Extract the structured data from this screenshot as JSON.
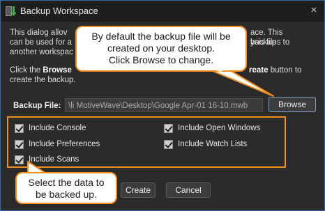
{
  "window": {
    "title": "Backup Workspace",
    "icon": "backup-arrow-icon",
    "close_glyph": "×"
  },
  "dialog": {
    "paragraph1": "This dialog allows you to create a backup of your workspace. This backup can be used for a new installation and to share analysis files to another workspace.",
    "paragraph1_visible_lines": [
      "This dialog allov",
      "can be used for a",
      "another workspac"
    ],
    "paragraph1_line_tails": [
      "ace. This backup",
      "ysis files to",
      ""
    ],
    "paragraph2_line1_start": "Click the ",
    "paragraph2_bold1": "Browse",
    "paragraph2_bold2": "reate",
    "paragraph2_line1_end": " button to",
    "paragraph2_line2": "create the backup."
  },
  "backup_file": {
    "label": "Backup File:",
    "value": "\\li MotiveWave\\Desktop\\Google Apr-01 16-10.mwb",
    "browse_label": "Browse"
  },
  "options": [
    {
      "label": "Include Console",
      "checked": true
    },
    {
      "label": "Include Open Windows",
      "checked": true
    },
    {
      "label": "Include Preferences",
      "checked": true
    },
    {
      "label": "Include Watch Lists",
      "checked": true
    },
    {
      "label": "Include Scans",
      "checked": true
    }
  ],
  "buttons": {
    "create": "Create",
    "cancel": "Cancel"
  },
  "callouts": {
    "browse_tip": [
      "By default the backup file will be",
      "created on your desktop.",
      "Click Browse to change."
    ],
    "options_tip": [
      "Select the data to",
      "be backed up."
    ]
  },
  "colors": {
    "accent_orange": "#f38d1e",
    "window_bg": "#2b2b2b",
    "title_bg": "#1e1e1e",
    "border_blue": "#2f6bb3"
  }
}
